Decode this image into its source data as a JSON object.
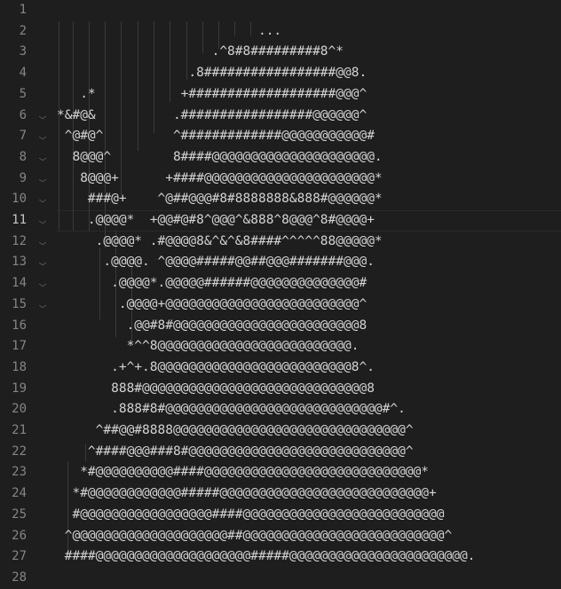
{
  "editor": {
    "active_line": 11,
    "lines": [
      {
        "n": "1",
        "text": ""
      },
      {
        "n": "2",
        "text": "                          ..."
      },
      {
        "n": "3",
        "text": "                    .^8#8#########8^*"
      },
      {
        "n": "4",
        "text": "                 .8#################@@8."
      },
      {
        "n": "5",
        "text": "   .*           +###################@@@^"
      },
      {
        "n": "6",
        "text": "*&#@&          .#################@@@@@@^"
      },
      {
        "n": "7",
        "text": " ^@#@^         ^#############@@@@@@@@@@@#"
      },
      {
        "n": "8",
        "text": "  8@@@^        8####@@@@@@@@@@@@@@@@@@@@@."
      },
      {
        "n": "9",
        "text": "   8@@@+      +####@@@@@@@@@@@@@@@@@@@@@@*"
      },
      {
        "n": "10",
        "text": "    ###@+    ^@##@@@#8#8888888&888#@@@@@@*"
      },
      {
        "n": "11",
        "text": "    .@@@@*  +@@#@#8^@@@^&888^8@@@^8#@@@@+"
      },
      {
        "n": "12",
        "text": "     .@@@@* .#@@@@8&^&^&8####^^^^^88@@@@@*"
      },
      {
        "n": "13",
        "text": "      .@@@@. ^@@@@#####@@##@@@#######@@@."
      },
      {
        "n": "14",
        "text": "       .@@@@*.@@@@@######@@@@@@@@@@@@@@#"
      },
      {
        "n": "15",
        "text": "        .@@@@+@@@@@@@@@@@@@@@@@@@@@@@@@^"
      },
      {
        "n": "16",
        "text": "         .@@#8#@@@@@@@@@@@@@@@@@@@@@@@@8"
      },
      {
        "n": "17",
        "text": "         *^^8@@@@@@@@@@@@@@@@@@@@@@@@@."
      },
      {
        "n": "18",
        "text": "       .+^+.8@@@@@@@@@@@@@@@@@@@@@@@@@8^."
      },
      {
        "n": "19",
        "text": "       888#@@@@@@@@@@@@@@@@@@@@@@@@@@@@@8"
      },
      {
        "n": "20",
        "text": "       .888#8#@@@@@@@@@@@@@@@@@@@@@@@@@@@@#^."
      },
      {
        "n": "21",
        "text": "     ^##@@#8888@@@@@@@@@@@@@@@@@@@@@@@@@@@@@@^"
      },
      {
        "n": "22",
        "text": "    ^####@@@###8#@@@@@@@@@@@@@@@@@@@@@@@@@@@@^"
      },
      {
        "n": "23",
        "text": "   *#@@@@@@@@@@####@@@@@@@@@@@@@@@@@@@@@@@@@@@@*"
      },
      {
        "n": "24",
        "text": "  *#@@@@@@@@@@@@#####@@@@@@@@@@@@@@@@@@@@@@@@@@@+"
      },
      {
        "n": "25",
        "text": "  #@@@@@@@@@@@@@@@@@####@@@@@@@@@@@@@@@@@@@@@@@@@@"
      },
      {
        "n": "26",
        "text": " ^@@@@@@@@@@@@@@@@@@@@##@@@@@@@@@@@@@@@@@@@@@@@@@@^"
      },
      {
        "n": "27",
        "text": " ####@@@@@@@@@@@@@@@@@@@@#####@@@@@@@@@@@@@@@@@@@@@@@."
      },
      {
        "n": "28",
        "text": ""
      }
    ],
    "fold_icon": "chevron-down-icon"
  }
}
